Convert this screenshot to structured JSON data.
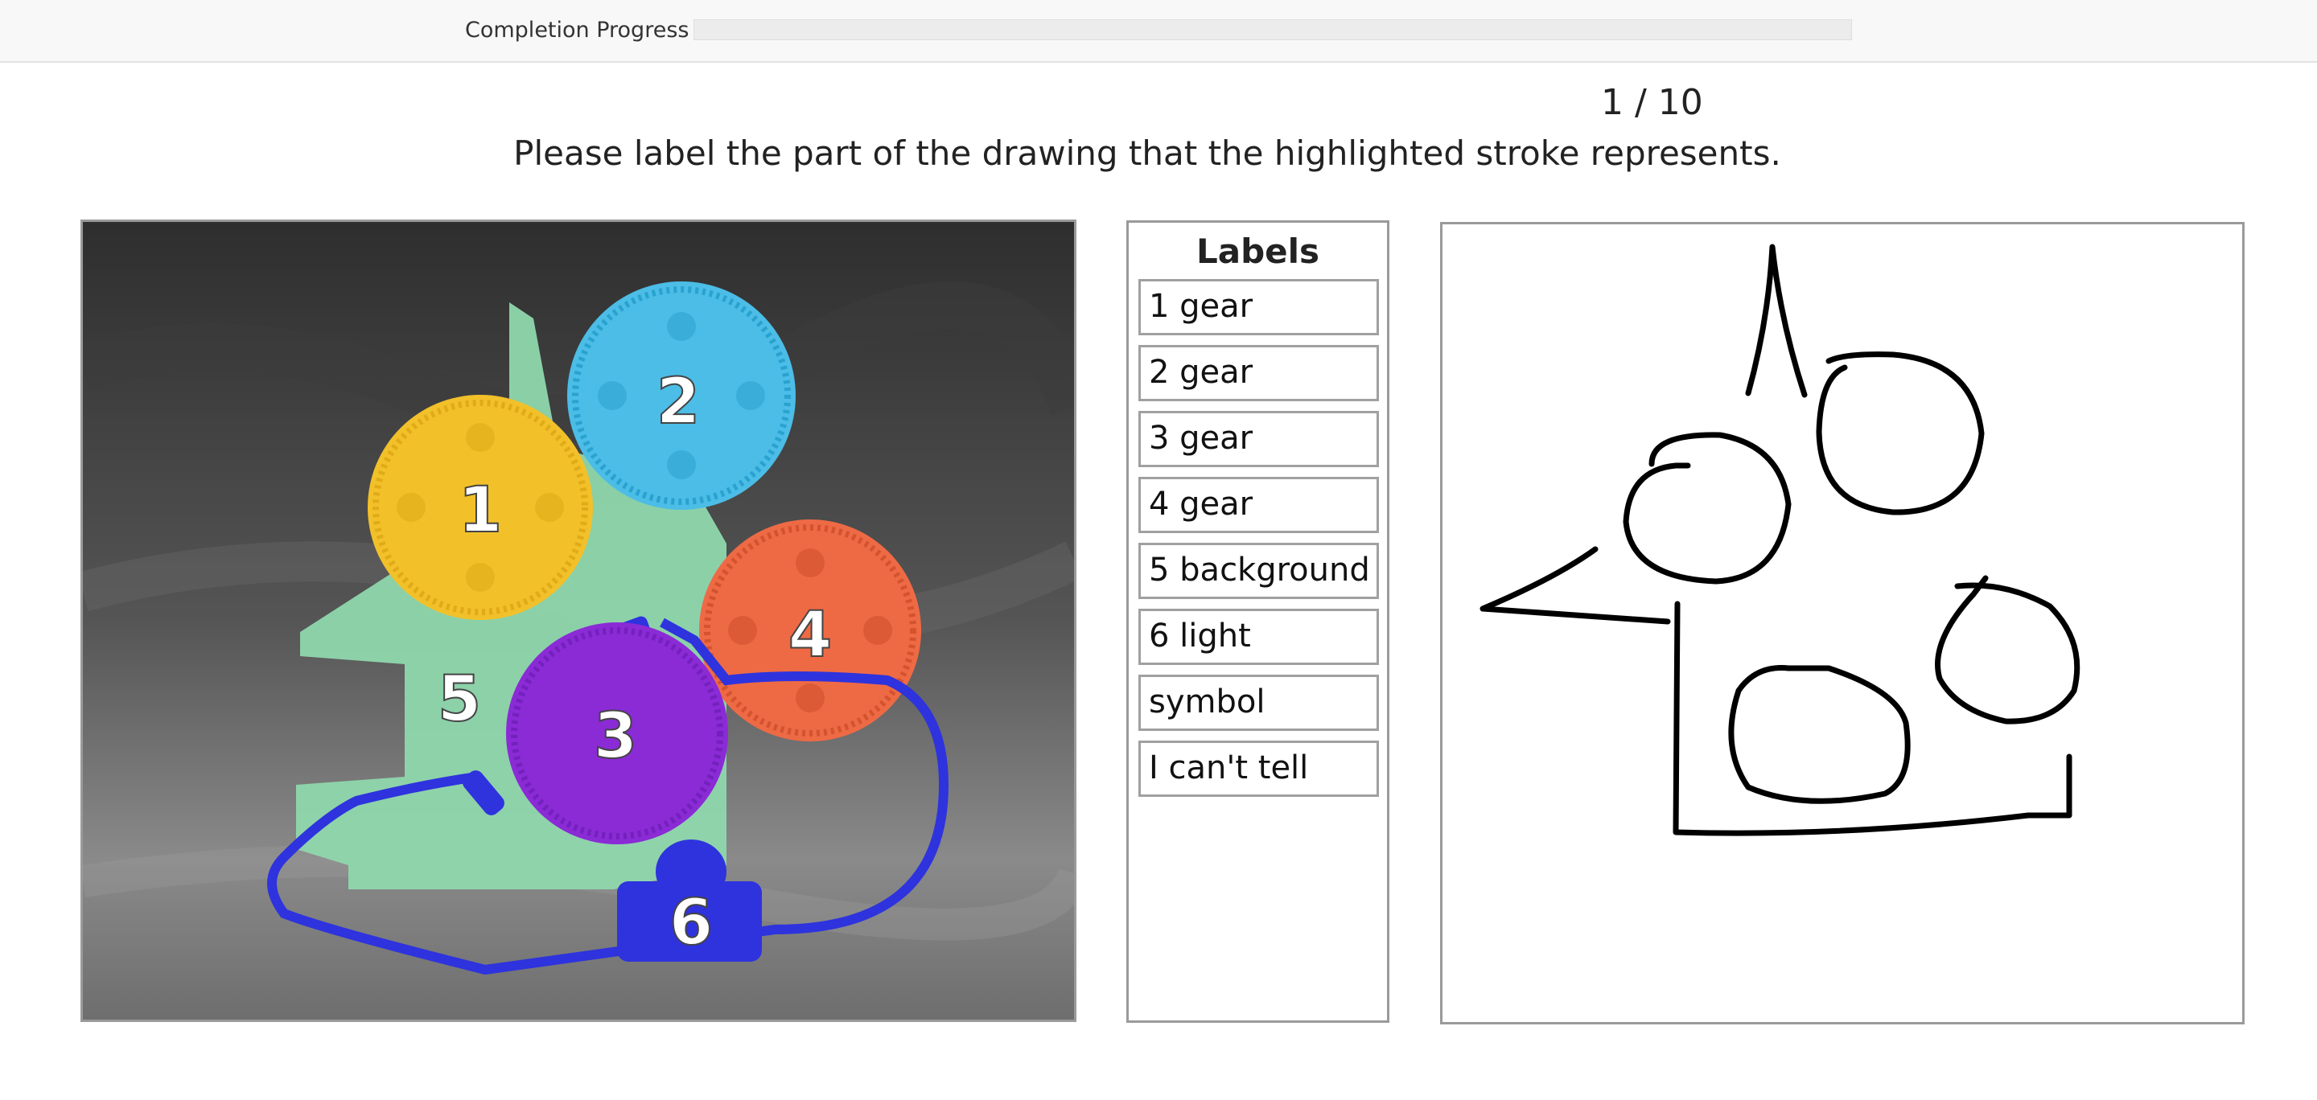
{
  "progress": {
    "label": "Completion Progress",
    "fraction": 0.0
  },
  "counter": "1 / 10",
  "instruction": "Please label the part of the drawing that the highlighted stroke represents.",
  "photo": {
    "part_numbers": [
      "1",
      "2",
      "3",
      "4",
      "5",
      "6"
    ],
    "colors": {
      "part1": "#f2c12a",
      "part2": "#4bbde6",
      "part3": "#8a2bd6",
      "part4": "#ee6a45",
      "part5": "#8fd7ad",
      "part6": "#2e33dd"
    }
  },
  "labels": {
    "title": "Labels",
    "options": [
      "1 gear",
      "2 gear",
      "3 gear",
      "4 gear",
      "5 background",
      "6 light",
      "symbol",
      "I can't tell"
    ]
  }
}
